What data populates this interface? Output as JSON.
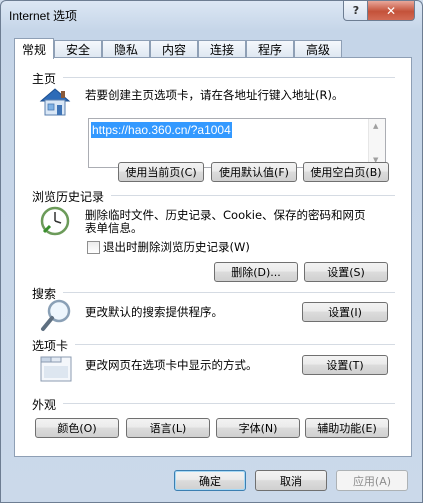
{
  "window": {
    "title": "Internet 选项",
    "help_glyph": "?",
    "close_glyph": "✕"
  },
  "tabs": [
    "常规",
    "安全",
    "隐私",
    "内容",
    "连接",
    "程序",
    "高级"
  ],
  "home": {
    "heading": "主页",
    "instruction": "若要创建主页选项卡，请在各地址行键入地址(R)。",
    "url": "https://hao.360.cn/?a1004",
    "buttons": {
      "use_current": "使用当前页(C)",
      "use_default": "使用默认值(F)",
      "use_blank": "使用空白页(B)"
    }
  },
  "history": {
    "heading": "浏览历史记录",
    "description_line1": "删除临时文件、历史记录、Cookie、保存的密码和网页",
    "description_line2": "表单信息。",
    "checkbox_label": "退出时删除浏览历史记录(W)",
    "checkbox_checked": false,
    "buttons": {
      "delete": "删除(D)...",
      "settings": "设置(S)"
    }
  },
  "search": {
    "heading": "搜索",
    "description": "更改默认的搜索提供程序。",
    "settings": "设置(I)"
  },
  "tabs_group": {
    "heading": "选项卡",
    "description": "更改网页在选项卡中显示的方式。",
    "settings": "设置(T)"
  },
  "appearance": {
    "heading": "外观",
    "buttons": {
      "colors": "颜色(O)",
      "languages": "语言(L)",
      "fonts": "字体(N)",
      "accessibility": "辅助功能(E)"
    }
  },
  "footer": {
    "ok": "确定",
    "cancel": "取消",
    "apply": "应用(A)"
  }
}
